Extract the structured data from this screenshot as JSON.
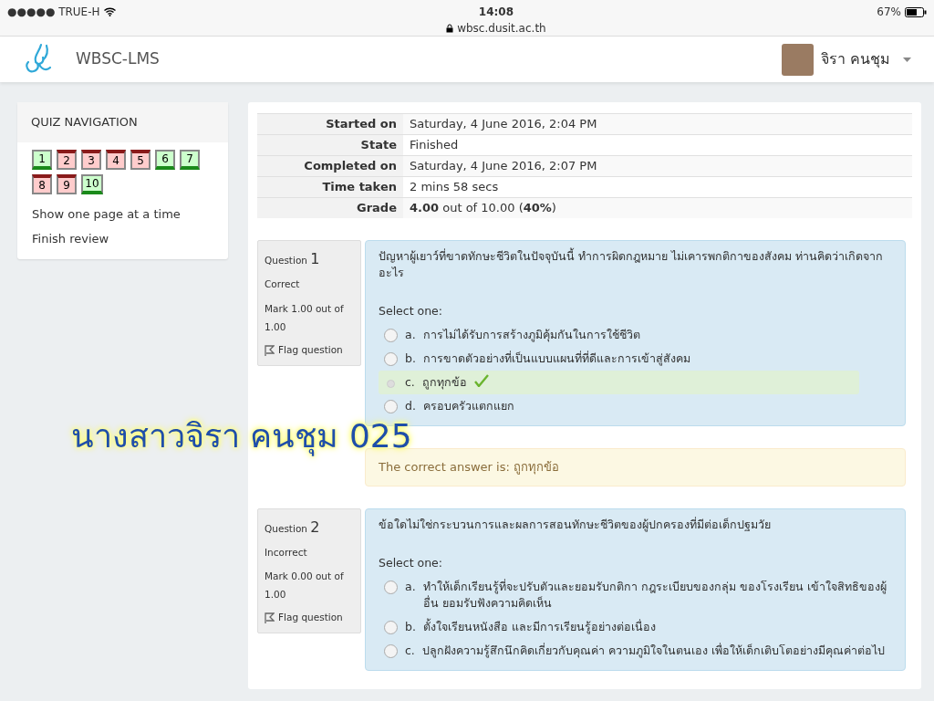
{
  "status_bar": {
    "carrier": "●●●●● TRUE-H",
    "time": "14:08",
    "url": "wbsc.dusit.ac.th",
    "battery": "67%"
  },
  "navbar": {
    "brand": "WBSC-LMS",
    "user": "จิรา คนชุม"
  },
  "quiz_navigation": {
    "title": "QUIZ NAVIGATION",
    "buttons": [
      {
        "label": "1",
        "correct": true
      },
      {
        "label": "2",
        "correct": false
      },
      {
        "label": "3",
        "correct": false
      },
      {
        "label": "4",
        "correct": false
      },
      {
        "label": "5",
        "correct": false
      },
      {
        "label": "6",
        "correct": true
      },
      {
        "label": "7",
        "correct": true
      },
      {
        "label": "8",
        "correct": false
      },
      {
        "label": "9",
        "correct": false
      },
      {
        "label": "10",
        "correct": true
      }
    ],
    "links": [
      "Show one page at a time",
      "Finish review"
    ]
  },
  "summary": [
    {
      "label": "Started on",
      "value": "Saturday, 4 June 2016, 2:04 PM"
    },
    {
      "label": "State",
      "value": "Finished"
    },
    {
      "label": "Completed on",
      "value": "Saturday, 4 June 2016, 2:07 PM"
    },
    {
      "label": "Time taken",
      "value": "2 mins 58 secs"
    },
    {
      "label": "Grade",
      "value": "**4.00** out of 10.00 (**40%**)"
    }
  ],
  "questions": [
    {
      "label": "Question",
      "number": "1",
      "status": "Correct",
      "mark": "Mark 1.00 out of 1.00",
      "flag": "Flag question",
      "text": "ปัญหาผู้เยาว์ที่ขาดทักษะชีวิตในปัจจุบันนี้ ทำการผิดกฎหมาย ไม่เคารพกติกาของสังคม ท่านคิดว่าเกิดจากอะไร",
      "prompt": "Select one:",
      "options": [
        {
          "letter": "a.",
          "text": "การไม่ได้รับการสร้างภูมิคุ้มกันในการใช้ชีวิต",
          "selected": false
        },
        {
          "letter": "b.",
          "text": "การขาดตัวอย่างที่เป็นแบบแผนที่ที่ดีและการเข้าสู่สังคม",
          "selected": false
        },
        {
          "letter": "c.",
          "text": "ถูกทุกข้อ",
          "selected": true
        },
        {
          "letter": "d.",
          "text": "ครอบครัวแตกแยก",
          "selected": false
        }
      ],
      "feedback": "The correct answer is: ถูกทุกข้อ"
    },
    {
      "label": "Question",
      "number": "2",
      "status": "Incorrect",
      "mark": "Mark 0.00 out of 1.00",
      "flag": "Flag question",
      "text": "ข้อใดไม่ใช่กระบวนการและผลการสอนทักษะชีวิตของผู้ปกครองที่มีต่อเด็กปฐมวัย",
      "prompt": "Select one:",
      "options": [
        {
          "letter": "a.",
          "text": "ทำให้เด็กเรียนรู้ที่จะปรับตัวและยอมรับกติกา กฎระเบียบของกลุ่ม ของโรงเรียน เข้าใจสิทธิของผู้อื่น ยอมรับฟังความคิดเห็น",
          "selected": false
        },
        {
          "letter": "b.",
          "text": "ตั้งใจเรียนหนังสือ และมีการเรียนรู้อย่างต่อเนื่อง",
          "selected": false
        },
        {
          "letter": "c.",
          "text": "ปลูกฝังความรู้สึกนึกคิดเกี่ยวกับคุณค่า ความภูมิใจในตนเอง เพื่อให้เด็กเติบโตอย่างมีคุณค่าต่อไป",
          "selected": false
        }
      ]
    }
  ],
  "annotation": "นางสาวจิรา คนชุม 025"
}
